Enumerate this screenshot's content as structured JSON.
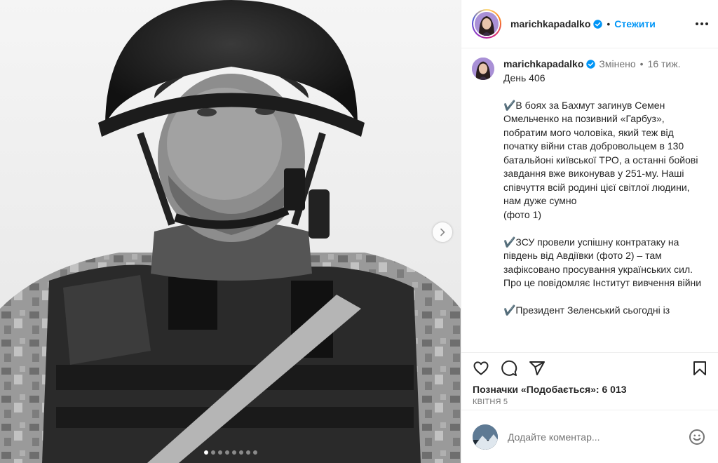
{
  "post": {
    "username": "marichkapadalko",
    "follow_label": "Стежити",
    "separator": "•",
    "edited_label": "Змінено",
    "age": "16 тиж.",
    "caption": "День 406\n\n✔️В боях за Бахмут загинув Семен Омельченко на позивний «Гарбуз», побратим мого чоловіка, який теж від початку війни став добровольцем в 130 батальйоні київської ТРО, а останні бойові завдання вже виконував у 251-му. Наші співчуття всій родині цієї світлої людини, нам дуже сумно\n(фото 1)\n\n✔️ЗСУ провели успішну контратаку на південь від Авдіївки (фото 2) – там зафіксовано просування українських сил. Про це повідомляє Інститут вивчення війни\n\n✔️Президент Зеленський сьогодні із",
    "likes": "Позначки «Подобається»: 6 013",
    "date": "КВІТНЯ 5",
    "comment_placeholder": "Додайте коментар..."
  },
  "carousel": {
    "total": 8,
    "current": 1
  },
  "colors": {
    "accent": "#0095f6",
    "verified": "#0095f6",
    "text": "#262626",
    "muted": "#737373"
  },
  "icons": [
    "verified-badge-icon",
    "more-options-icon",
    "chevron-right-icon",
    "heart-icon",
    "comment-icon",
    "share-icon",
    "bookmark-icon",
    "emoji-icon"
  ]
}
